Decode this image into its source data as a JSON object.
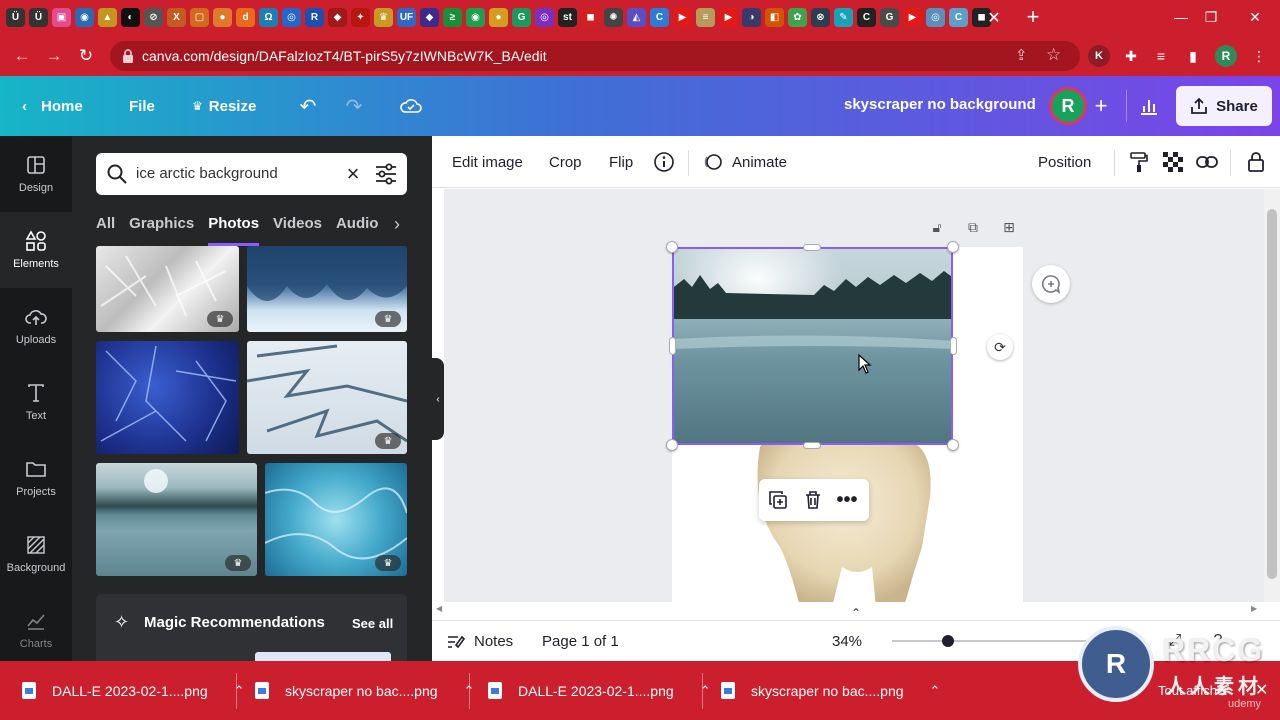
{
  "browser": {
    "tab_icons": [
      {
        "name": "tab-favicon-1",
        "glyph": "Ü",
        "color": "#333333"
      },
      {
        "name": "tab-favicon-2",
        "glyph": "Ü",
        "color": "#333333"
      },
      {
        "name": "tab-favicon-3",
        "glyph": "▣",
        "color": "#e44b8d"
      },
      {
        "name": "tab-favicon-4",
        "glyph": "◉",
        "color": "#2b6cb0"
      },
      {
        "name": "tab-favicon-5",
        "glyph": "▲",
        "color": "#c69520"
      },
      {
        "name": "tab-favicon-6",
        "glyph": "◐",
        "color": "#111111"
      },
      {
        "name": "tab-favicon-7",
        "glyph": "⊘",
        "color": "#555555"
      },
      {
        "name": "tab-favicon-8",
        "glyph": "X",
        "color": "#c45a20"
      },
      {
        "name": "tab-favicon-9",
        "glyph": "▢",
        "color": "#d2691e"
      },
      {
        "name": "tab-favicon-10",
        "glyph": "●",
        "color": "#e07a2a"
      },
      {
        "name": "tab-favicon-11",
        "glyph": "d",
        "color": "#e86a1a"
      },
      {
        "name": "tab-favicon-12",
        "glyph": "Ω",
        "color": "#1b7fb5"
      },
      {
        "name": "tab-favicon-13",
        "glyph": "◎",
        "color": "#2567c9"
      },
      {
        "name": "tab-favicon-14",
        "glyph": "R",
        "color": "#1c4fb0"
      },
      {
        "name": "tab-favicon-15",
        "glyph": "◆",
        "color": "#a31919"
      },
      {
        "name": "tab-favicon-16",
        "glyph": "✦",
        "color": "#b8170f"
      },
      {
        "name": "tab-favicon-17",
        "glyph": "♛",
        "color": "#c79b23"
      },
      {
        "name": "tab-favicon-18",
        "glyph": "UF",
        "color": "#2f69c4"
      },
      {
        "name": "tab-favicon-19",
        "glyph": "◆",
        "color": "#3a2b8c"
      },
      {
        "name": "tab-favicon-20",
        "glyph": "≥",
        "color": "#1a8f3a"
      },
      {
        "name": "tab-favicon-21",
        "glyph": "◉",
        "color": "#1f9e4e"
      },
      {
        "name": "tab-favicon-22",
        "glyph": "●",
        "color": "#d39d20"
      },
      {
        "name": "tab-favicon-23",
        "glyph": "G",
        "color": "#1a9a5b"
      },
      {
        "name": "tab-favicon-24",
        "glyph": "◎",
        "color": "#7b2fbf"
      },
      {
        "name": "tab-favicon-25",
        "glyph": "st",
        "color": "#222222"
      },
      {
        "name": "tab-favicon-26",
        "glyph": "◼",
        "color": "#d12020"
      },
      {
        "name": "tab-favicon-27",
        "glyph": "✺",
        "color": "#444444"
      },
      {
        "name": "tab-favicon-28",
        "glyph": "◭",
        "color": "#5a4ec7"
      },
      {
        "name": "tab-favicon-29",
        "glyph": "C",
        "color": "#2d7bd6"
      },
      {
        "name": "tab-favicon-30",
        "glyph": "▶",
        "color": "#e01919"
      },
      {
        "name": "tab-favicon-31",
        "glyph": "≡",
        "color": "#b79b5a"
      },
      {
        "name": "tab-favicon-32",
        "glyph": "▶",
        "color": "#e01919"
      },
      {
        "name": "tab-favicon-33",
        "glyph": "◑",
        "color": "#3a3a6a"
      },
      {
        "name": "tab-favicon-34",
        "glyph": "◧",
        "color": "#d35400"
      },
      {
        "name": "tab-favicon-35",
        "glyph": "✿",
        "color": "#3fa34d"
      },
      {
        "name": "tab-favicon-36",
        "glyph": "⊗",
        "color": "#2c3e50"
      },
      {
        "name": "tab-favicon-37",
        "glyph": "✎",
        "color": "#17a2b8"
      },
      {
        "name": "tab-favicon-38",
        "glyph": "C",
        "color": "#222222"
      },
      {
        "name": "tab-favicon-39",
        "glyph": "G",
        "color": "#4a4a4a"
      },
      {
        "name": "tab-favicon-40",
        "glyph": "▶",
        "color": "#e01919"
      },
      {
        "name": "tab-favicon-41",
        "glyph": "◎",
        "color": "#5a8fb9"
      },
      {
        "name": "tab-favicon-42",
        "glyph": "C",
        "color": "#5aa0c8"
      },
      {
        "name": "tab-favicon-43",
        "glyph": "◼",
        "color": "#222222"
      }
    ],
    "url": "canva.com/design/DAFalzIozT4/BT-pirS5y7zIWNBcW7K_BA/edit",
    "ext_k": "K",
    "profile_initial": "R"
  },
  "header": {
    "home": "Home",
    "file": "File",
    "resize": "Resize",
    "doc_title": "skyscraper no background",
    "avatar_initial": "R",
    "share": "Share"
  },
  "rail": [
    {
      "name": "rail-design",
      "icon": "design-icon",
      "label": "Design"
    },
    {
      "name": "rail-elements",
      "icon": "elements-icon",
      "label": "Elements"
    },
    {
      "name": "rail-uploads",
      "icon": "uploads-icon",
      "label": "Uploads"
    },
    {
      "name": "rail-text",
      "icon": "text-icon",
      "label": "Text"
    },
    {
      "name": "rail-projects",
      "icon": "projects-icon",
      "label": "Projects"
    },
    {
      "name": "rail-background",
      "icon": "background-icon",
      "label": "Background"
    },
    {
      "name": "rail-charts",
      "icon": "charts-icon",
      "label": "Charts"
    }
  ],
  "panel": {
    "search_value": "ice arctic background",
    "tabs": [
      "All",
      "Graphics",
      "Photos",
      "Videos",
      "Audio"
    ],
    "active_tab": "Photos",
    "magic_title": "Magic Recommendations",
    "see_all": "See all"
  },
  "toolbar": {
    "edit_image": "Edit image",
    "crop": "Crop",
    "flip": "Flip",
    "animate": "Animate",
    "position": "Position"
  },
  "footer": {
    "notes": "Notes",
    "page_indicator": "Page 1 of 1",
    "zoom": "34%",
    "zoom_fraction": 0.28
  },
  "downloads": [
    {
      "name": "download-item-1",
      "label": "DALL-E 2023-02-1....png"
    },
    {
      "name": "download-item-2",
      "label": "skyscraper no bac....png"
    },
    {
      "name": "download-item-3",
      "label": "DALL-E 2023-02-1....png"
    },
    {
      "name": "download-item-4",
      "label": "skyscraper no bac....png"
    }
  ],
  "downloads_show_all": "Tout afficher",
  "watermark": {
    "logo": "RRCG",
    "sub": "人人素材",
    "udemy": "udemy"
  },
  "colors": {
    "accent": "#8b5cf6",
    "chrome": "#cc1f2e",
    "rail": "#18191b",
    "panel": "#252627"
  }
}
